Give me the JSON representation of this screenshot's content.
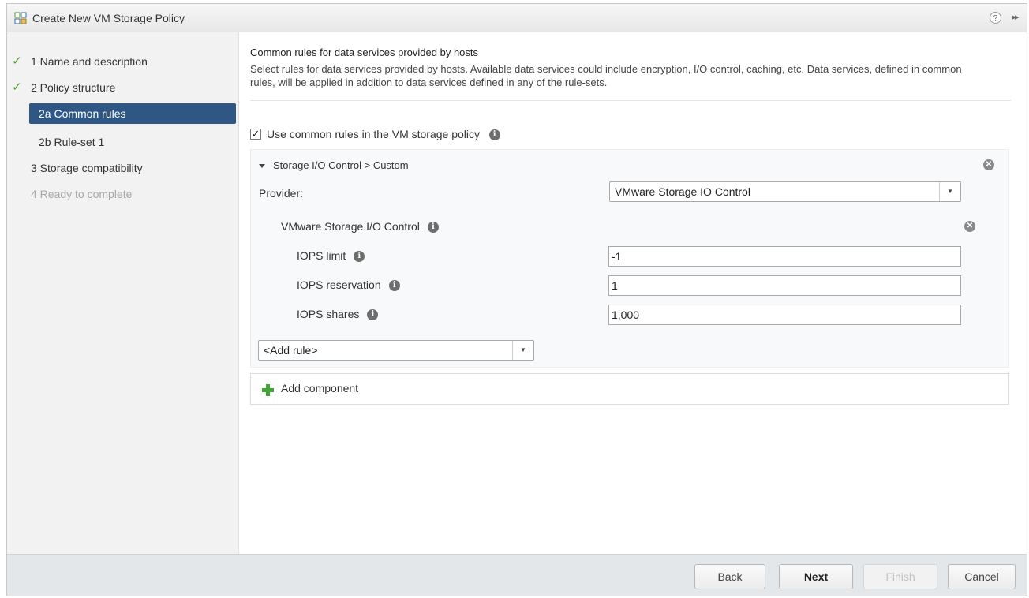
{
  "window": {
    "title": "Create New VM Storage Policy",
    "help_icon": "?",
    "expand_icon": "▸▸"
  },
  "nav": {
    "items": [
      {
        "label": "1  Name and description",
        "state": "done",
        "check": "✓"
      },
      {
        "label": "2  Policy structure",
        "state": "done",
        "check": "✓"
      },
      {
        "label": "2a  Common rules",
        "state": "active"
      },
      {
        "label": "2b  Rule-set 1",
        "state": "normal"
      },
      {
        "label": "3  Storage compatibility",
        "state": "normal"
      },
      {
        "label": "4  Ready to complete",
        "state": "disabled"
      }
    ]
  },
  "main": {
    "heading": "Common rules for data services provided by hosts",
    "description": "Select rules for data services provided by hosts. Available data services could include encryption, I/O control, caching, etc. Data services, defined in common rules, will be applied in addition to data services defined in any of the rule-sets.",
    "use_common_rules": {
      "checked": true,
      "check_glyph": "✓",
      "label": "Use common rules in the VM storage policy"
    },
    "component": {
      "header": "Storage I/O Control > Custom",
      "provider_label": "Provider:",
      "provider_value": "VMware Storage IO Control",
      "section_title": "VMware Storage I/O Control",
      "fields": [
        {
          "label": "IOPS limit",
          "value": "-1"
        },
        {
          "label": "IOPS reservation",
          "value": "1"
        },
        {
          "label": "IOPS shares",
          "value": "1,000"
        }
      ],
      "add_rule": "<Add rule>"
    },
    "add_component": "Add component"
  },
  "footer": {
    "back": "Back",
    "next": "Next",
    "finish": "Finish",
    "cancel": "Cancel"
  },
  "icons": {
    "info": "i",
    "remove": "✕",
    "dropdown": "▼"
  },
  "colors": {
    "nav_active_bg": "#2f5785",
    "check_green": "#4a9d2a",
    "add_green": "#3fa535"
  }
}
